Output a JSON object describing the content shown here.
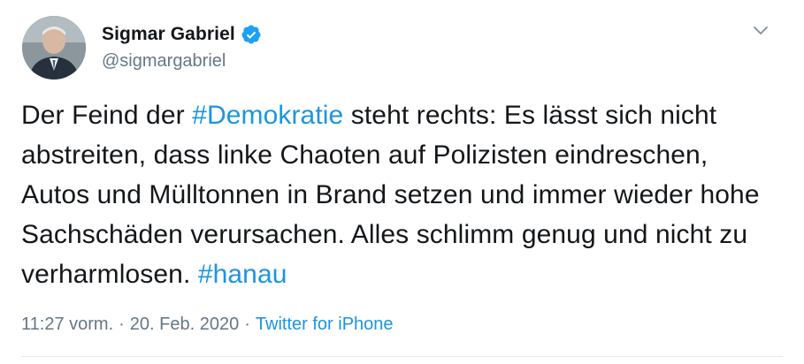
{
  "author": {
    "name": "Sigmar Gabriel",
    "handle": "@sigmargabriel",
    "verified": true
  },
  "tweet": {
    "text_segments": [
      {
        "text": "Der Feind der ",
        "type": "text"
      },
      {
        "text": "#Demokratie",
        "type": "hashtag"
      },
      {
        "text": " steht rechts: Es lässt sich nicht abstreiten, dass linke Chaoten auf Polizisten eindreschen, Autos und Mülltonnen in Brand setzen und immer wieder hohe Sachschäden verursachen. Alles schlimm genug und nicht zu verharmlosen. ",
        "type": "text"
      },
      {
        "text": "#hanau",
        "type": "hashtag"
      }
    ]
  },
  "meta": {
    "time": "11:27 vorm.",
    "separator": "·",
    "date": "20. Feb. 2020",
    "source": "Twitter for iPhone"
  },
  "colors": {
    "link": "#1b95e0",
    "secondary_text": "#657786",
    "primary_text": "#14171a",
    "verified_badge": "#1da1f2"
  },
  "icons": {
    "verified": "verified-badge-icon",
    "menu": "chevron-down-icon"
  }
}
